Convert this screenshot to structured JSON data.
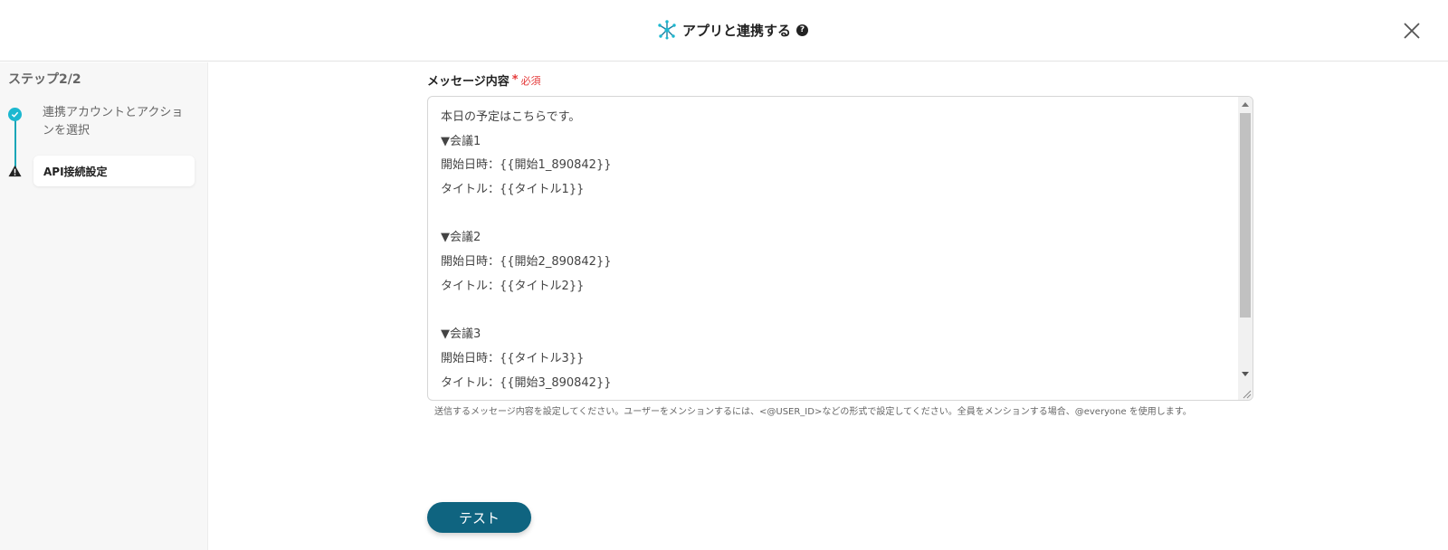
{
  "header": {
    "title": "アプリと連携する",
    "help_icon": "question-circle-icon",
    "app_icon": "network-icon",
    "close_icon": "close-icon"
  },
  "sidebar": {
    "step_label": "ステップ2/2",
    "steps": [
      {
        "label": "連携アカウントとアクションを選択",
        "status": "done",
        "icon": "check-circle-icon"
      },
      {
        "label": "API接続設定",
        "status": "warning",
        "icon": "warning-triangle-icon"
      }
    ],
    "accent_color": "#1cb8d0"
  },
  "form": {
    "field_label": "メッセージ内容",
    "required_star": "*",
    "required_text": "必須",
    "message_lines": [
      "本日の予定はこちらです。",
      "▼会議1",
      "開始日時：{{開始1_890842}}",
      "タイトル：{{タイトル1}}",
      "",
      "▼会議2",
      "開始日時：{{開始2_890842}}",
      "タイトル：{{タイトル2}}",
      "",
      "▼会議3",
      "開始日時：{{タイトル3}}",
      "タイトル：{{開始3_890842}}"
    ],
    "help_text": "送信するメッセージ内容を設定してください。ユーザーをメンションするには、<@USER_ID>などの形式で設定してください。全員をメンションする場合、@everyone を使用します。"
  },
  "actions": {
    "test_label": "テスト",
    "button_color": "#0f6480"
  }
}
